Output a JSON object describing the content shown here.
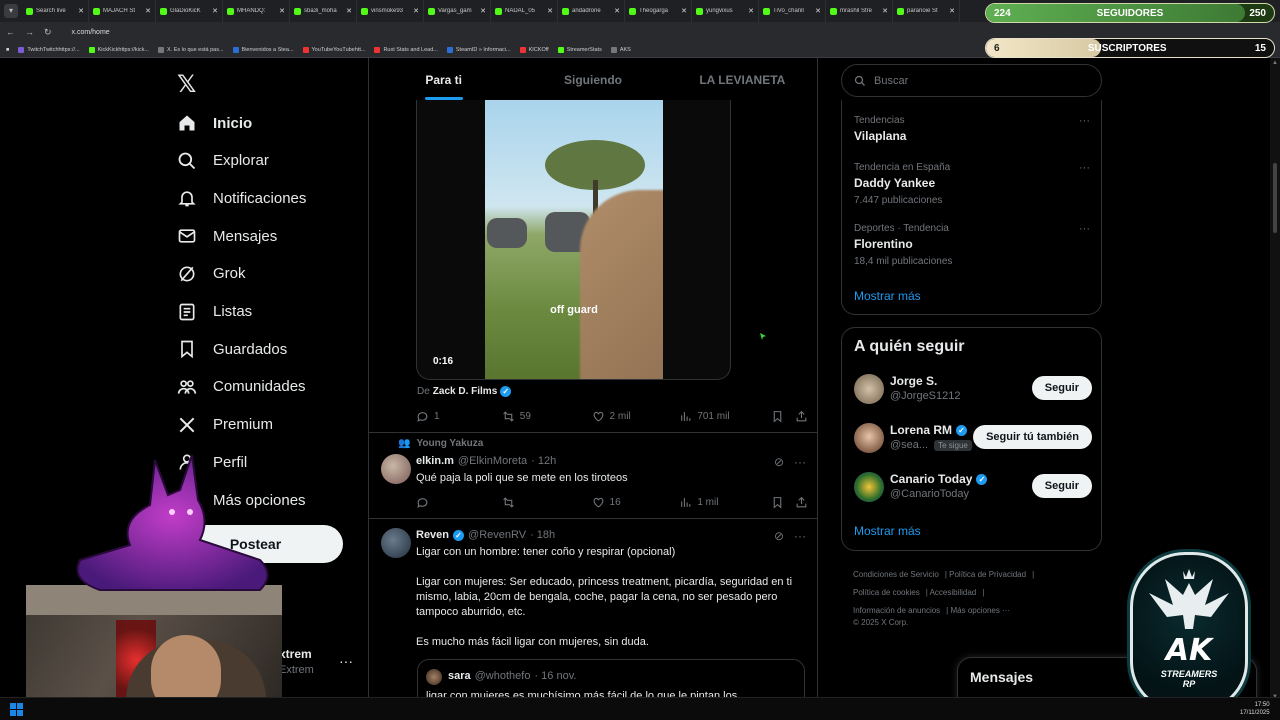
{
  "browser": {
    "tabs": [
      {
        "label": "Search live",
        "favicon": "green"
      },
      {
        "label": "MAJACH St",
        "favicon": "green"
      },
      {
        "label": "GlaDioKicK",
        "favicon": "green"
      },
      {
        "label": "MHANDQ:",
        "favicon": "green"
      },
      {
        "label": "sba3i_moha",
        "favicon": "green"
      },
      {
        "label": "vinsmoke93",
        "favicon": "green"
      },
      {
        "label": "Vargas_gam",
        "favicon": "green"
      },
      {
        "label": "NADAL_05",
        "favicon": "green"
      },
      {
        "label": "andadrone",
        "favicon": "green"
      },
      {
        "label": "Theogarga",
        "favicon": "green"
      },
      {
        "label": "yungvixus",
        "favicon": "green"
      },
      {
        "label": "TiVo_chanll",
        "favicon": "green"
      },
      {
        "label": "mrashil Stre",
        "favicon": "green"
      },
      {
        "label": "paranoie St",
        "favicon": "green"
      }
    ],
    "url": "x.com/home",
    "bookmarks": [
      {
        "label": "TwitchTwitchhttps://...",
        "color": "purple"
      },
      {
        "label": "KickKickhttps://kick...",
        "color": "green"
      },
      {
        "label": "X. Es lo que está pas...",
        "color": "gray"
      },
      {
        "label": "Bienvenidos a Stea...",
        "color": "blue"
      },
      {
        "label": "YouTubeYouTubehtt...",
        "color": "red"
      },
      {
        "label": "Rust Stats and Lead...",
        "color": "red"
      },
      {
        "label": "SteamID » Informaci...",
        "color": "blue"
      },
      {
        "label": "KICKOff",
        "color": "red"
      },
      {
        "label": "StreamerStats",
        "color": "green"
      },
      {
        "label": "AKS",
        "color": "gray"
      }
    ]
  },
  "overlay": {
    "followers": {
      "left": "224",
      "label": "SEGUIDORES",
      "right": "250",
      "progress": 0.9
    },
    "subscribers": {
      "left": "6",
      "label": "SUSCRIPTORES",
      "right": "15",
      "progress": 0.4
    },
    "emblem_title": "AK",
    "emblem_sub1": "STREAMERS",
    "emblem_sub2": "RP"
  },
  "nav": {
    "items": [
      {
        "label": "Inicio",
        "icon": "home-icon",
        "active": true
      },
      {
        "label": "Explorar",
        "icon": "search-icon"
      },
      {
        "label": "Notificaciones",
        "icon": "bell-icon"
      },
      {
        "label": "Mensajes",
        "icon": "mail-icon"
      },
      {
        "label": "Grok",
        "icon": "grok-icon"
      },
      {
        "label": "Listas",
        "icon": "list-icon"
      },
      {
        "label": "Guardados",
        "icon": "bookmark-icon"
      },
      {
        "label": "Comunidades",
        "icon": "people-icon"
      },
      {
        "label": "Premium",
        "icon": "x-icon"
      },
      {
        "label": "Perfil",
        "icon": "person-icon"
      },
      {
        "label": "Más opciones",
        "icon": "more-circle-icon"
      }
    ],
    "post_label": "Postear",
    "profile_name": "xtrem",
    "profile_handle": "Extrem",
    "profile_more": "···"
  },
  "feed": {
    "tabs": [
      "Para ti",
      "Siguiendo",
      "LA LEVIANETA"
    ],
    "video_post": {
      "caption": "off guard",
      "duration": "0:16",
      "from_prefix": "De",
      "from_name": "Zack D. Films",
      "replies": "1",
      "reposts": "59",
      "likes": "2 mil",
      "views": "701 mil"
    },
    "tweet1": {
      "repost_note": "Young Yakuza",
      "name": "elkin.m",
      "handle": "@ElkinMoreta",
      "time": "· 12h",
      "text": "Qué paja la poli que se mete en los tiroteos",
      "replies": "",
      "reposts": "",
      "likes": "16",
      "views": "1 mil"
    },
    "tweet2": {
      "name": "Reven",
      "handle": "@RevenRV",
      "time": "· 18h",
      "text1": "Ligar con un hombre: tener coño y respirar (opcional)",
      "text2": "Ligar con mujeres: Ser educado, princess treatment, picardía, seguridad en ti mismo, labia, 20cm de bengala, coche, pagar la cena, no ser pesado pero tampoco aburrido, etc.",
      "text3": "Es mucho más fácil ligar con mujeres, sin duda.",
      "quote_name": "sara",
      "quote_handle": "@whothefo",
      "quote_time": "· 16 nov.",
      "quote_text": "ligar con mujeres es muchísimo más fácil de lo que le pintan los"
    }
  },
  "right": {
    "search_placeholder": "Buscar",
    "trends": [
      {
        "context": "Tendencias",
        "name": "Vilaplana",
        "count": ""
      },
      {
        "context": "Tendencia en España",
        "name": "Daddy Yankee",
        "count": "7.447 publicaciones"
      },
      {
        "context": "Deportes · Tendencia",
        "name": "Florentino",
        "count": "18,4 mil publicaciones"
      }
    ],
    "trends_more": "Mostrar más",
    "who_title": "A quién seguir",
    "who": [
      {
        "name": "Jorge S.",
        "handle": "@JorgeS1212",
        "verified": false,
        "badge": "",
        "button": "Seguir"
      },
      {
        "name": "Lorena RM",
        "handle": "@sea...",
        "verified": true,
        "badge": "Te sigue",
        "button": "Seguir tú también"
      },
      {
        "name": "Canario Today",
        "handle": "@CanarioToday",
        "verified": true,
        "badge": "",
        "button": "Seguir"
      }
    ],
    "who_more": "Mostrar más",
    "footer": {
      "l1": "Condiciones de Servicio",
      "l2": "Política de Privacidad",
      "l3": "Política de cookies",
      "l4": "Accesibilidad",
      "l5": "Información de anuncios",
      "l6": "Más opciones ···",
      "copyright": "© 2025 X Corp."
    },
    "messages_title": "Mensajes"
  },
  "taskbar": {
    "time": "17:50",
    "date": "17/11/2025"
  },
  "colors": {
    "accent": "#1d9bf0",
    "bg": "#000000",
    "muted": "#71767b"
  }
}
